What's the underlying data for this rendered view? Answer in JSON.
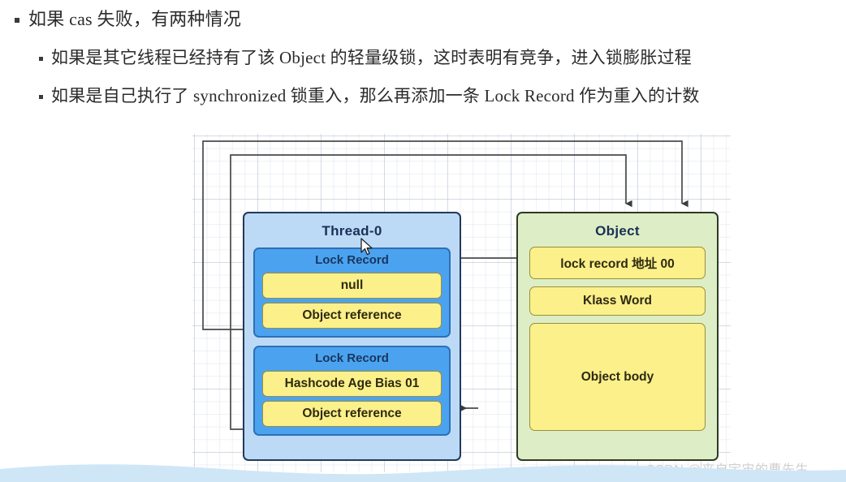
{
  "bullets": {
    "level1": "如果 cas 失败，有两种情况",
    "level2_a": "如果是其它线程已经持有了该 Object 的轻量级锁，这时表明有竞争，进入锁膨胀过程",
    "level2_b": "如果是自己执行了 synchronized 锁重入，那么再添加一条 Lock Record 作为重入的计数"
  },
  "diagram": {
    "thread": {
      "title": "Thread-0",
      "lock_records": [
        {
          "title": "Lock Record",
          "rows": [
            "null",
            "Object reference"
          ]
        },
        {
          "title": "Lock Record",
          "rows": [
            "Hashcode Age Bias 01",
            "Object reference"
          ]
        }
      ]
    },
    "object": {
      "title": "Object",
      "rows": [
        "lock record 地址 00",
        "Klass Word",
        "Object body"
      ]
    },
    "colors": {
      "thread_fill": "#bcd9f5",
      "thread_border": "#23395b",
      "lock_record_fill": "#4ba3f0",
      "lock_record_border": "#2e6fb5",
      "cell_fill": "#fbf08a",
      "cell_border": "#9a8f3a",
      "object_fill": "#ddeec6",
      "object_border": "#2d3b24",
      "connector": "#4a4a4a",
      "wave": "#cfe6f7"
    }
  },
  "watermark": "CSDN @来自宇宙的曹先生"
}
